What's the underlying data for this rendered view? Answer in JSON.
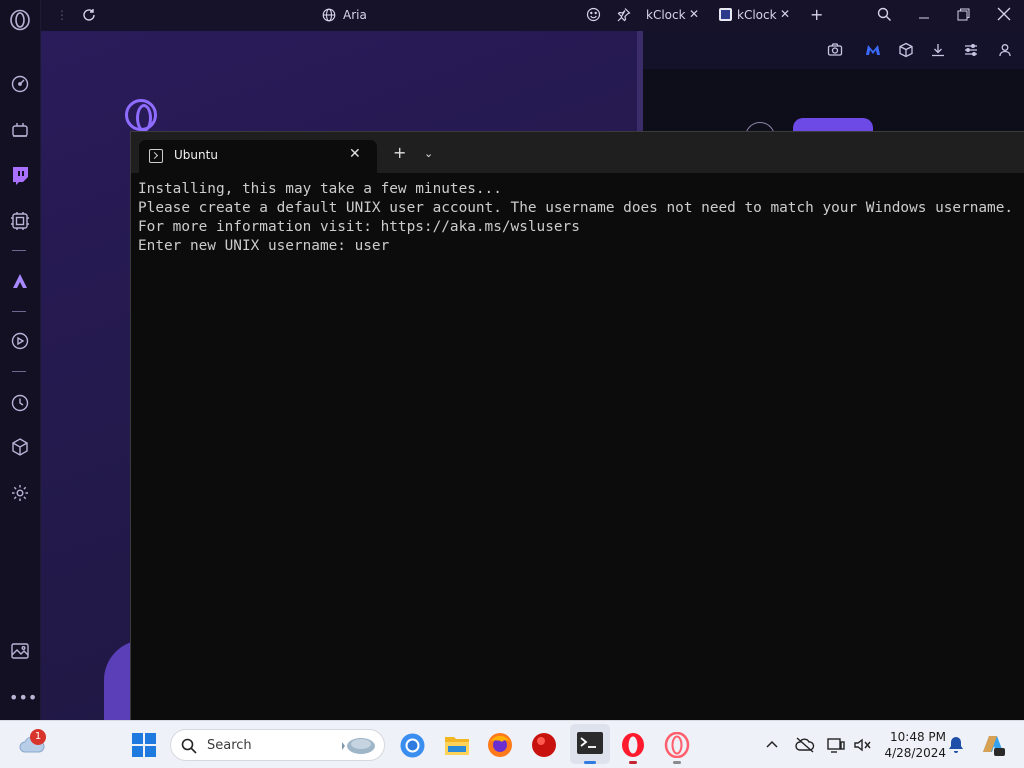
{
  "browser": {
    "address_label": "Aria",
    "tabs": [
      {
        "label": "kClock"
      },
      {
        "label": "kClock"
      }
    ]
  },
  "terminal": {
    "tab_title": "Ubuntu",
    "lines": [
      "Installing, this may take a few minutes...",
      "Please create a default UNIX user account. The username does not need to match your Windows username.",
      "For more information visit: https://aka.ms/wslusers",
      "Enter new UNIX username: user"
    ]
  },
  "taskbar": {
    "search_placeholder": "Search",
    "weather_badge": "1",
    "time": "10:48 PM",
    "date": "4/28/2024"
  },
  "colors": {
    "accent": "#8e6cff",
    "terminal_bg": "#0c0c0c",
    "terminal_text": "#cccccc"
  }
}
